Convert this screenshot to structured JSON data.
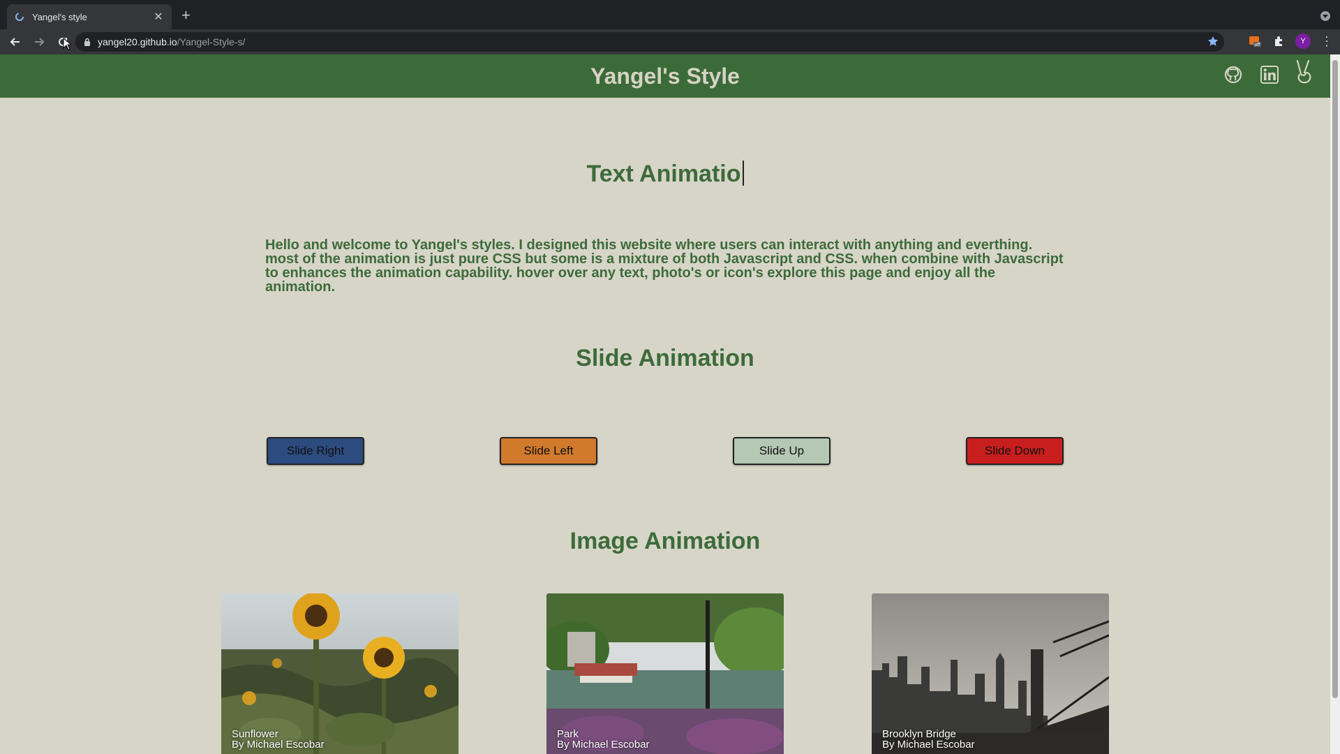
{
  "browser": {
    "tab_title": "Yangel's style",
    "url_host": "yangel20.github.io",
    "url_path": "/Yangel-Style-s/",
    "profile_initial": "Y"
  },
  "header": {
    "title": "Yangel's Style",
    "links": [
      "github-icon",
      "linkedin-icon",
      "peace-hand-icon"
    ]
  },
  "sections": {
    "text_animation": {
      "heading": "Text Animatio",
      "intro": "Hello and welcome to Yangel's styles. I designed this website where users can interact with anything and everthing. most of the animation is just pure CSS but some is a mixture of both Javascript and CSS. when combine with Javascript to enhances the animation capability. hover over any text, photo's or icon's explore this page and enjoy all the animation."
    },
    "slide_animation": {
      "heading": "Slide Animation",
      "buttons": [
        {
          "label": "Slide Right",
          "color": "#2c4b7f"
        },
        {
          "label": "Slide Left",
          "color": "#d17a2c"
        },
        {
          "label": "Slide Up",
          "color": "#b4c8b4"
        },
        {
          "label": "Slide Down",
          "color": "#c81e1e"
        }
      ]
    },
    "image_animation": {
      "heading": "Image Animation",
      "cards": [
        {
          "title": "Sunflower",
          "author": "By Michael Escobar"
        },
        {
          "title": "Park",
          "author": "By Michael Escobar"
        },
        {
          "title": "Brooklyn Bridge",
          "author": "By Michael Escobar"
        }
      ]
    }
  },
  "colors": {
    "page_bg": "#d7d5c8",
    "header_bg": "#3b6b39",
    "accent_text": "#3d6b3a"
  }
}
